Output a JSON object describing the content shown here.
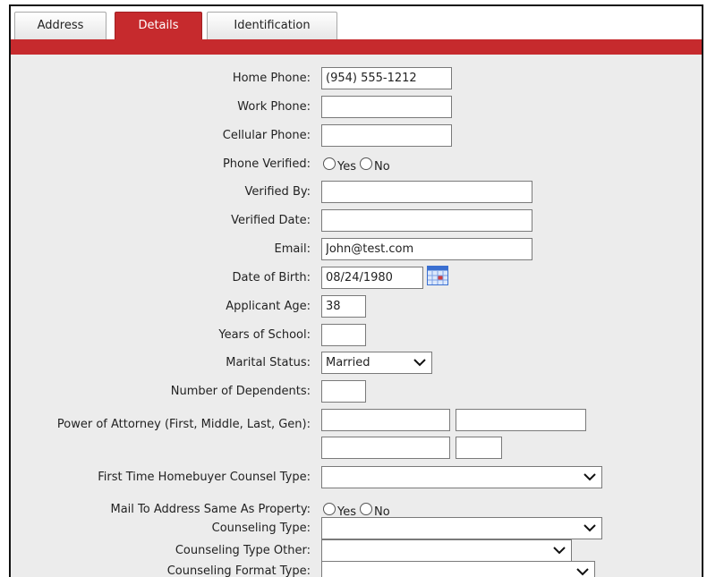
{
  "tabs": [
    {
      "label": "Address",
      "active": false
    },
    {
      "label": "Details",
      "active": true
    },
    {
      "label": "Identification",
      "active": false
    }
  ],
  "colors": {
    "accent": "#c62a2d",
    "panel": "#ececec"
  },
  "form": {
    "home_phone": {
      "label": "Home Phone:",
      "value": "(954) 555-1212"
    },
    "work_phone": {
      "label": "Work Phone:",
      "value": ""
    },
    "cellular_phone": {
      "label": "Cellular Phone:",
      "value": ""
    },
    "phone_verified": {
      "label": "Phone Verified:",
      "yes": "Yes",
      "no": "No",
      "selected": null
    },
    "verified_by": {
      "label": "Verified By:",
      "value": ""
    },
    "verified_date": {
      "label": "Verified Date:",
      "value": ""
    },
    "email": {
      "label": "Email:",
      "value": "John@test.com"
    },
    "date_of_birth": {
      "label": "Date of Birth:",
      "value": "08/24/1980",
      "icon": "calendar-icon"
    },
    "applicant_age": {
      "label": "Applicant Age:",
      "value": "38"
    },
    "years_of_school": {
      "label": "Years of School:",
      "value": ""
    },
    "marital_status": {
      "label": "Marital Status:",
      "value": "Married"
    },
    "number_of_dependents": {
      "label": "Number of Dependents:",
      "value": ""
    },
    "power_of_attorney": {
      "label": "Power of Attorney (First, Middle, Last, Gen):",
      "first": "",
      "middle": "",
      "last": "",
      "gen": ""
    },
    "first_time_homebuyer_counsel_type": {
      "label": "First Time Homebuyer Counsel Type:",
      "value": ""
    },
    "mail_to_address_same": {
      "label": "Mail To Address Same As Property:",
      "yes": "Yes",
      "no": "No",
      "selected": null
    },
    "counseling_type": {
      "label": "Counseling Type:",
      "value": ""
    },
    "counseling_type_other": {
      "label": "Counseling Type Other:",
      "value": ""
    },
    "counseling_format_type": {
      "label": "Counseling Format Type:",
      "value": ""
    }
  }
}
